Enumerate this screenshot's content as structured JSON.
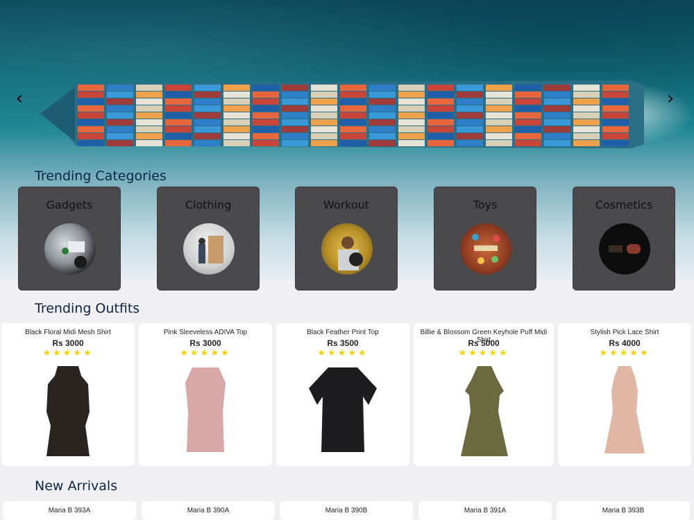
{
  "hero": {
    "prev_icon": "chevron-left-icon",
    "next_icon": "chevron-right-icon"
  },
  "sections": {
    "trending_categories": "Trending Categories",
    "trending_outfits": "Trending Outfits",
    "new_arrivals": "New Arrivals"
  },
  "categories": [
    {
      "label": "Gadgets"
    },
    {
      "label": "Clothing"
    },
    {
      "label": "Workout"
    },
    {
      "label": "Toys"
    },
    {
      "label": "Cosmetics"
    }
  ],
  "outfits": [
    {
      "name": "Black Floral Midi Mesh Shirt",
      "price": "Rs 3000",
      "rating": 5,
      "color": "#2b2522"
    },
    {
      "name": "Pink Sleeveless ADIVA Top",
      "price": "Rs 3000",
      "rating": 5,
      "color": "#d9a7a6"
    },
    {
      "name": "Black Feather Print Top",
      "price": "Rs 3500",
      "rating": 5,
      "color": "#1d1c1e"
    },
    {
      "name": "Billie & Blossom Green Keyhole Puff Midi Shirt",
      "price": "Rs 5000",
      "rating": 5,
      "color": "#6b6a3e"
    },
    {
      "name": "Stylish Pick Lace Shirt",
      "price": "Rs 4000",
      "rating": 5,
      "color": "#e0b7a4"
    }
  ],
  "new_arrivals": [
    {
      "name": "Maria B 393A"
    },
    {
      "name": "Maria B 390A"
    },
    {
      "name": "Maria B 390B"
    },
    {
      "name": "Maria B 391A"
    },
    {
      "name": "Maria B 393B"
    }
  ],
  "stars_text": "★★★★★"
}
